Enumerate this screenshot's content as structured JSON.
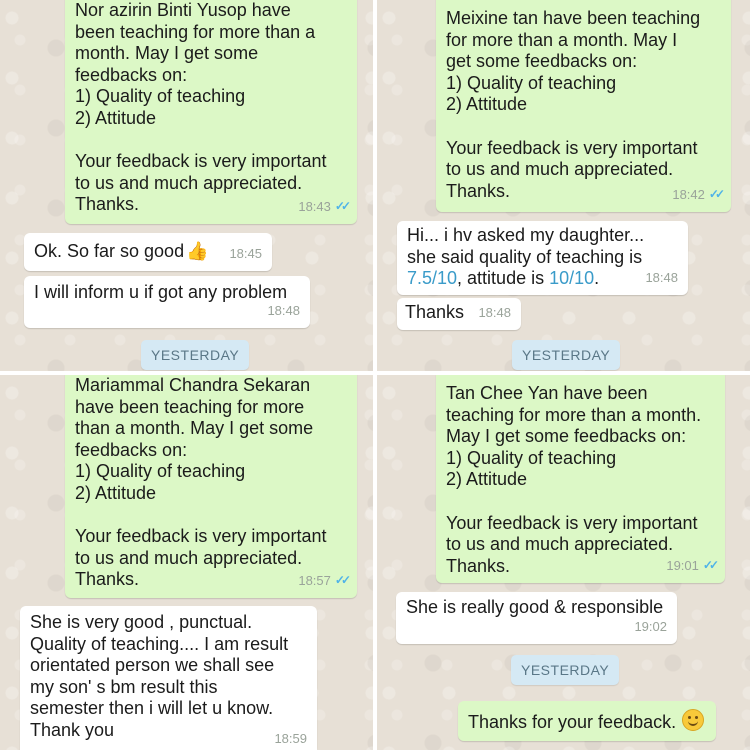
{
  "panels": [
    {
      "outgoing": {
        "text": "Nor azirin Binti Yusop have\nbeen teaching for more than a\nmonth. May I get some\nfeedbacks on:\n1) Quality of teaching\n2) Attitude\n\nYour feedback is very important\nto us and much appreciated.\nThanks.",
        "time": "18:43"
      },
      "incoming": [
        {
          "text": "Ok. So far so good",
          "emoji": "thumbs-up-emoji",
          "time": "18:45"
        },
        {
          "text": "I will inform u if got any problem",
          "time": "18:48"
        }
      ],
      "day_label": "YESTERDAY"
    },
    {
      "outgoing": {
        "text": "Meixine tan have been teaching\nfor more than a month. May I\nget some feedbacks on:\n1) Quality of teaching\n2) Attitude\n\nYour feedback is very important\nto us and much appreciated.\nThanks.",
        "time": "18:42"
      },
      "incoming": [
        {
          "line1": "Hi... i hv asked my daughter...",
          "line2": "she said quality of teaching is",
          "score1": "7.5/10",
          "mid": ", attitude is ",
          "score2": "10/10",
          "end": ".",
          "time": "18:48"
        },
        {
          "text": "Thanks",
          "time": "18:48"
        }
      ],
      "day_label": "YESTERDAY"
    },
    {
      "outgoing": {
        "text": "Mariammal Chandra Sekaran\nhave been teaching for more\nthan a month. May I get some\nfeedbacks on:\n1) Quality of teaching\n2) Attitude\n\nYour feedback is very important\nto us and much appreciated.\nThanks.",
        "time": "18:57"
      },
      "incoming": [
        {
          "text": "She is very good , punctual.\nQuality of teaching.... I am result\norientated person we shall see\nmy son' s bm result this\nsemester then i will let u know.\nThank you",
          "time": "18:59"
        }
      ]
    },
    {
      "outgoing": {
        "text": "Tan Chee Yan have been\nteaching for more than a month.\nMay I get some feedbacks on:\n1) Quality of teaching\n2) Attitude\n\nYour feedback is very important\nto us and much appreciated.\nThanks.",
        "time": "19:01"
      },
      "incoming": [
        {
          "text": "She is really good & responsible",
          "time": "19:02"
        }
      ],
      "day_label": "YESTERDAY",
      "outgoing2": {
        "text": "Thanks for your feedback.",
        "emoji": "smiling-face-emoji"
      }
    }
  ],
  "colors": {
    "outgoing_bubble": "#dcf8c6",
    "incoming_bubble": "#ffffff",
    "chat_background": "#e7e0d6",
    "day_label_bg": "#d5e9f4",
    "score_highlight": "#3a9bc9",
    "read_ticks": "#4fb3e8"
  }
}
